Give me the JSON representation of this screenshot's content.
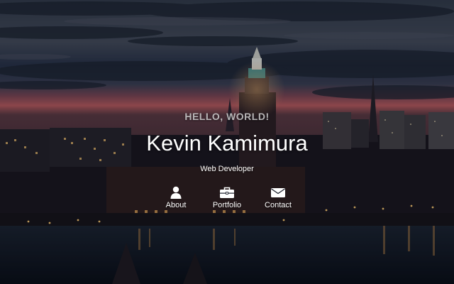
{
  "hero": {
    "greeting": "HELLO, WORLD!",
    "name": "Kevin Kamimura",
    "role": "Web Developer"
  },
  "nav": [
    {
      "label": "About",
      "icon": "user-icon"
    },
    {
      "label": "Portfolio",
      "icon": "briefcase-icon"
    },
    {
      "label": "Contact",
      "icon": "envelope-icon"
    }
  ],
  "colors": {
    "text": "#ffffff",
    "greeting": "#e1e1e1",
    "sky_dark": "#1f2a3a",
    "sunset_glow": "#c2585e",
    "water": "#0e1624"
  }
}
